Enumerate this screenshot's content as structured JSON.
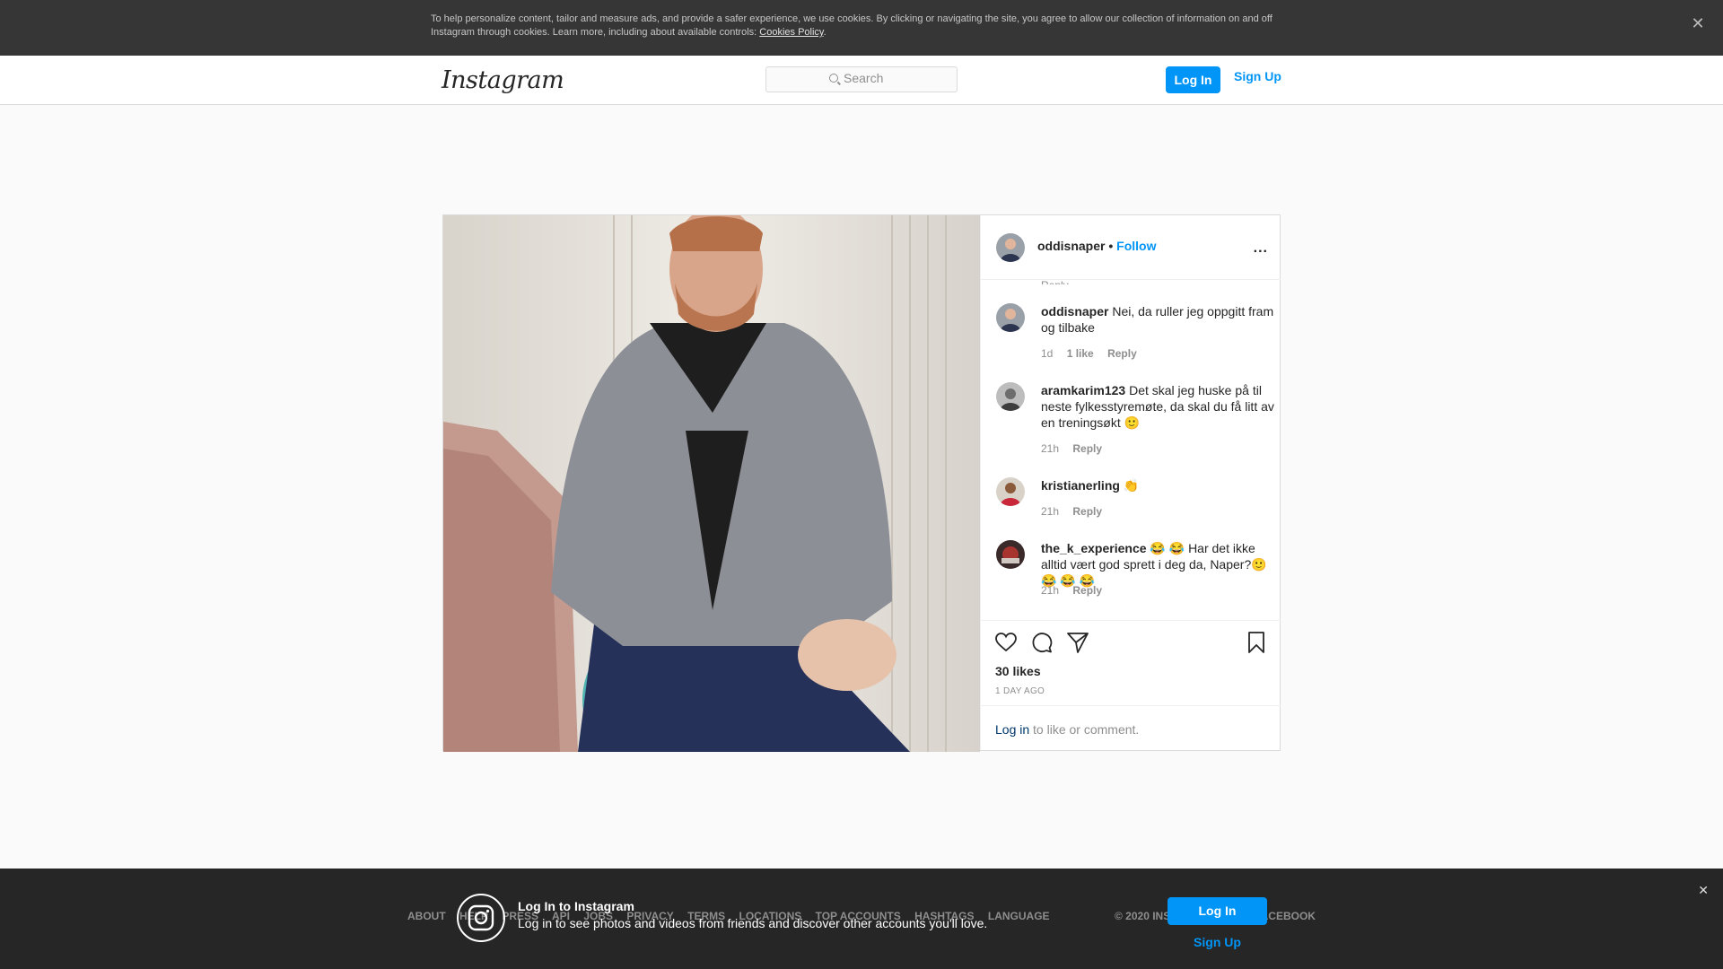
{
  "cookie_banner": {
    "text": "To help personalize content, tailor and measure ads, and provide a safer experience, we use cookies. By clicking or navigating the site, you agree to allow our collection of information on and off Instagram through cookies. Learn more, including about available controls:",
    "policy_link": "Cookies Policy",
    "close_glyph": "✕"
  },
  "header": {
    "logo": "Instagram",
    "search_placeholder": "Search",
    "login_label": "Log In",
    "signup_label": "Sign Up"
  },
  "post": {
    "username": "oddisnaper",
    "separator": "•",
    "follow_label": "Follow",
    "more_label": "...",
    "comments": [
      {
        "user": "oddisnaper",
        "text": "Nei, da ruller jeg oppgitt fram og tilbake",
        "time": "1d",
        "likes": "1 like",
        "reply": "Reply"
      },
      {
        "user": "aramkarim123",
        "text": "Det skal jeg huske på til neste fylkesstyremøte, da skal du få litt av en treningsøkt 🙂",
        "time": "21h",
        "reply": "Reply"
      },
      {
        "user": "kristianerling",
        "text": "👏",
        "time": "21h",
        "reply": "Reply"
      },
      {
        "user": "the_k_experience",
        "text": "😂 😂 Har det ikke alltid vært god sprett i deg da, Naper?🙂 😂 😂 😂",
        "time": "21h",
        "reply": "Reply"
      }
    ],
    "likes_count": "30 likes",
    "time_ago": "1 DAY AGO",
    "login_prompt_link": "Log in",
    "login_prompt_text": "to like or comment.",
    "icons": [
      "heart-icon",
      "comment-icon",
      "share-icon",
      "bookmark-icon"
    ]
  },
  "footer": {
    "links": [
      "ABOUT",
      "HELP",
      "PRESS",
      "API",
      "JOBS",
      "PRIVACY",
      "TERMS",
      "LOCATIONS",
      "TOP ACCOUNTS",
      "HASHTAGS",
      "LANGUAGE"
    ],
    "copyright": "© 2020 INSTAGRAM FROM FACEBOOK"
  },
  "login_promo": {
    "title": "Log In to Instagram",
    "subtitle": "Log in to see photos and videos from friends and discover other accounts you'll love.",
    "login_label": "Log In",
    "signup_label": "Sign Up",
    "close_glyph": "✕"
  },
  "colors": {
    "accent": "#0095f6",
    "dark_bar": "#262626",
    "cookie_bar": "#363636"
  }
}
